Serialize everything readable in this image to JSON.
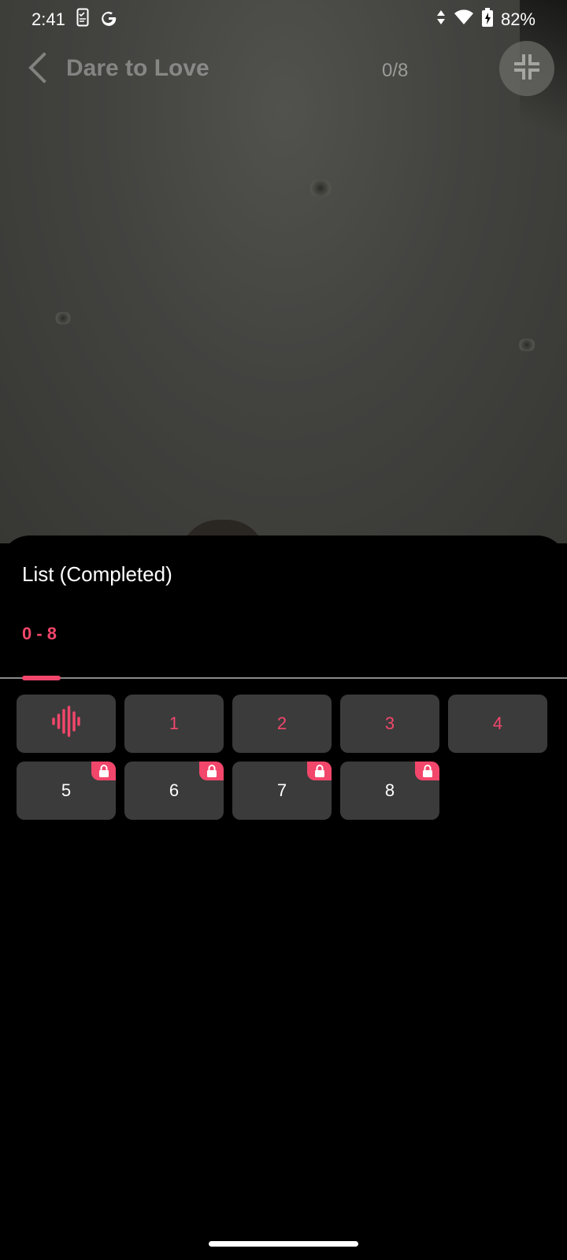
{
  "status_bar": {
    "time": "2:41",
    "battery_pct": "82%",
    "icons": [
      "phone-checklist-icon",
      "google-g-icon",
      "data-arrows-icon",
      "wifi-icon",
      "battery-charging-icon"
    ]
  },
  "header": {
    "title": "Dare to Love",
    "counter": "0/8",
    "back_icon": "chevron-left-icon",
    "collapse_icon": "collapse-fullscreen-icon"
  },
  "sheet": {
    "title": "List (Completed)",
    "tabs": [
      {
        "label": "0 - 8",
        "selected": true
      }
    ],
    "episodes": [
      {
        "label": "",
        "state": "playing",
        "icon": "audio-wave-icon"
      },
      {
        "label": "1",
        "state": "unlocked"
      },
      {
        "label": "2",
        "state": "unlocked"
      },
      {
        "label": "3",
        "state": "unlocked"
      },
      {
        "label": "4",
        "state": "unlocked"
      },
      {
        "label": "5",
        "state": "locked"
      },
      {
        "label": "6",
        "state": "locked"
      },
      {
        "label": "7",
        "state": "locked"
      },
      {
        "label": "8",
        "state": "locked"
      }
    ]
  },
  "colors": {
    "accent": "#f2466b",
    "tile_bg": "#3b3b3b",
    "sheet_bg": "#000000"
  }
}
